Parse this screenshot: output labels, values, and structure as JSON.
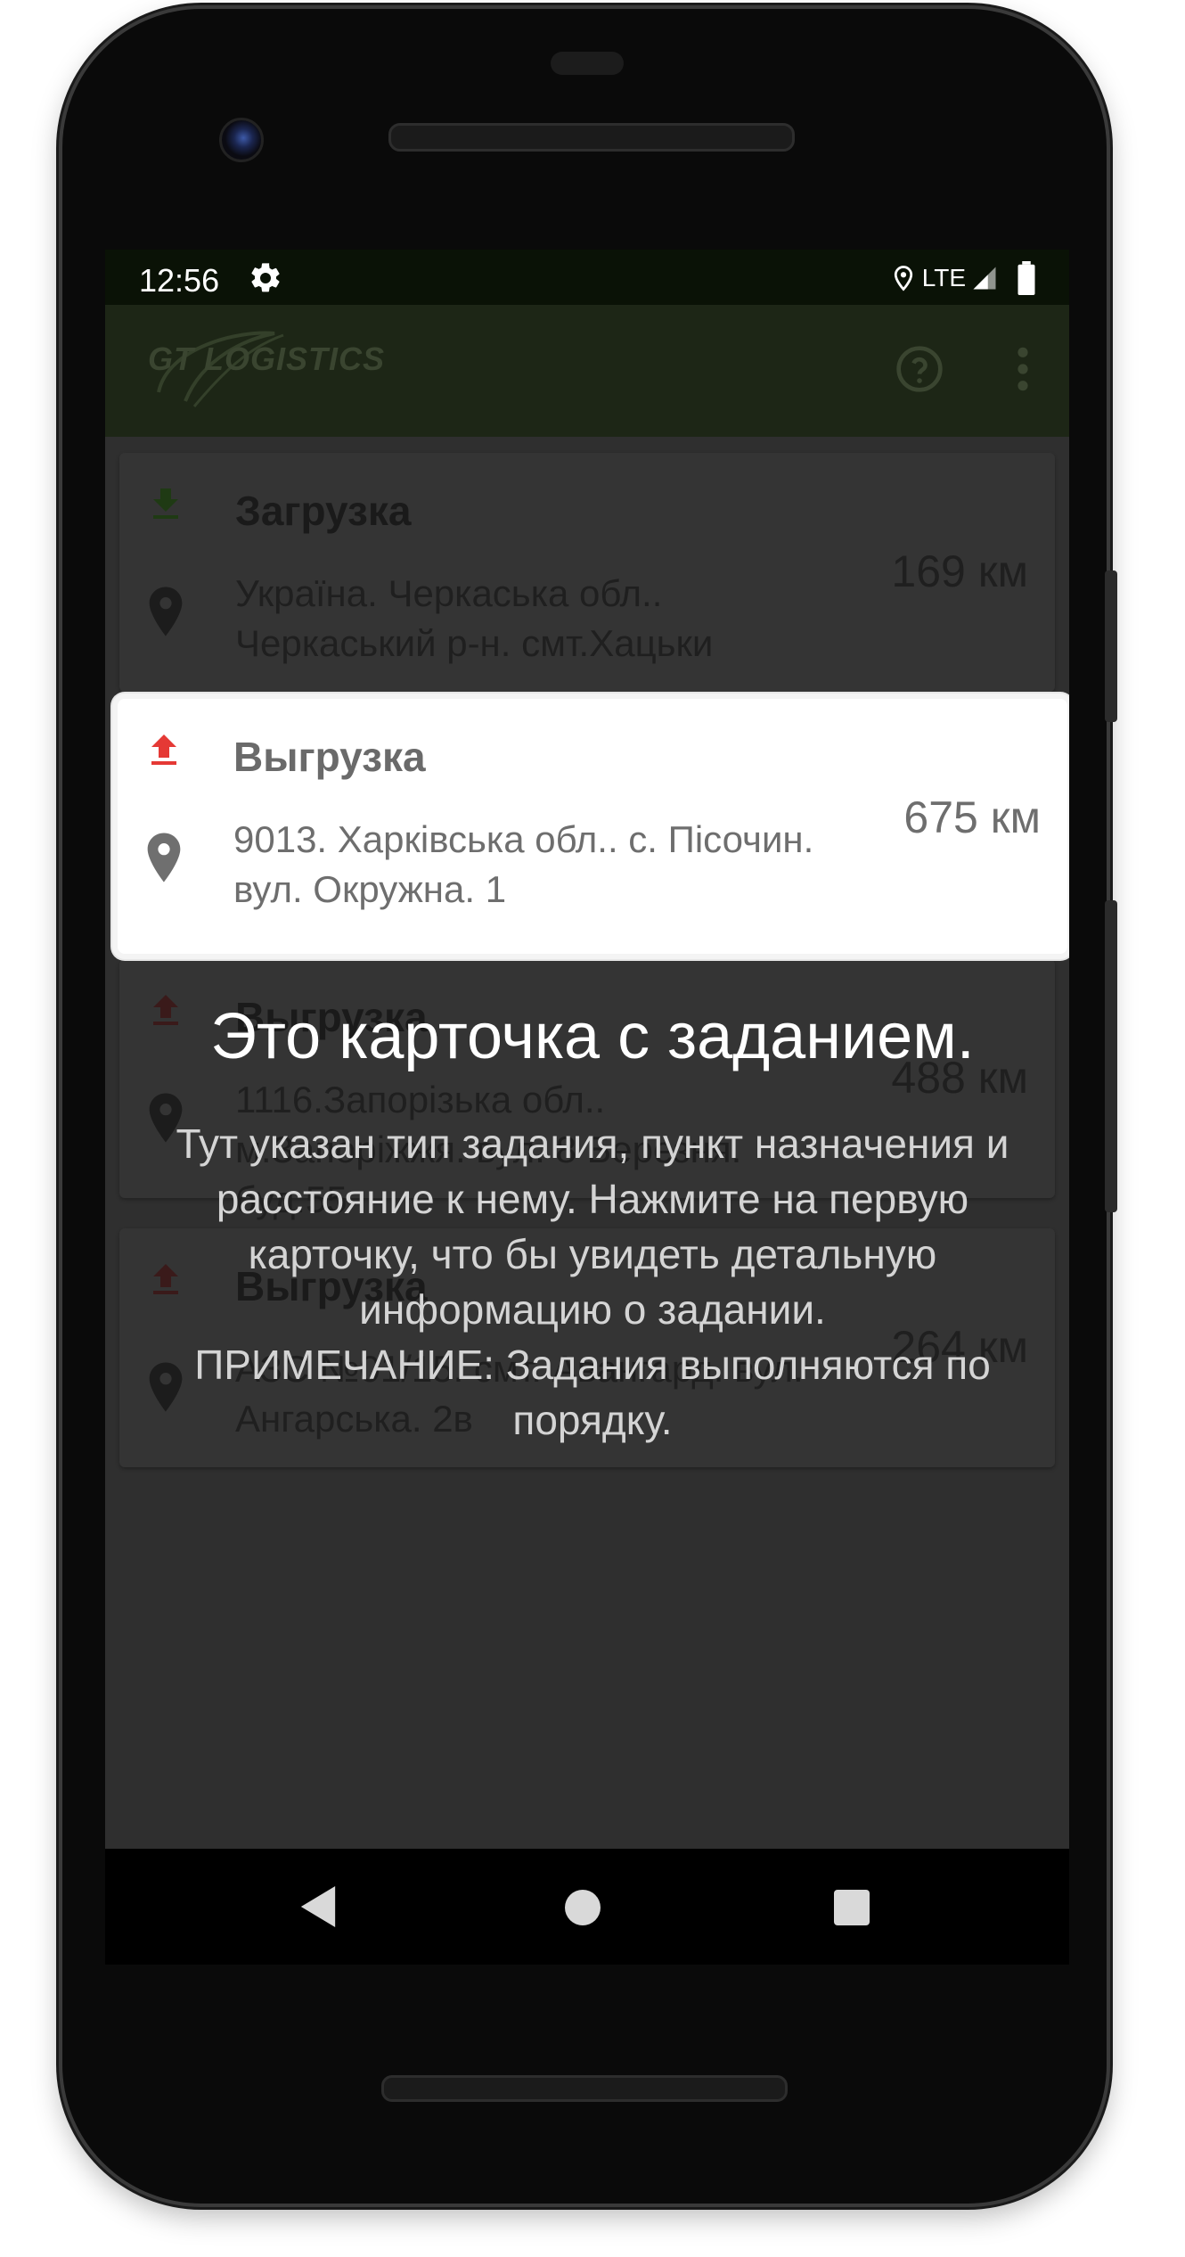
{
  "status_bar": {
    "time": "12:56",
    "network": "LTE",
    "icons": [
      "gear-icon",
      "location-icon",
      "signal-icon",
      "battery-icon"
    ]
  },
  "app_bar": {
    "logo_text": "GT LOGISTICS",
    "actions": [
      "help-icon",
      "more-vert-icon"
    ]
  },
  "tasks": [
    {
      "type": "Загрузка",
      "icon": "download-icon",
      "icon_color": "#2e7d32",
      "address": "Україна. Черкаська обл.. Черкаський р-н. смт.Хацьки",
      "distance": "169 км"
    },
    {
      "type": "Выгрузка",
      "icon": "upload-icon",
      "icon_color": "#e53935",
      "address": "9013. Харківська обл.. с. Пісочин. вул. Окружна. 1",
      "distance": "675 км"
    },
    {
      "type": "Выгрузка",
      "icon": "upload-icon",
      "icon_color": "#e53935",
      "address": "1116.Запорізька обл.. м.Запоріжжя. вул. 8 Березня. буд.55",
      "distance": "488 км"
    },
    {
      "type": "Выгрузка",
      "icon": "upload-icon",
      "icon_color": "#e53935",
      "address": "АЗС №01/15. смт. Авангард. вул. Ангарська. 2в",
      "distance": "264 км"
    }
  ],
  "tutorial": {
    "title": "Это карточка с заданием.",
    "body": "Тут указан тип задания, пункт назначения и расстояние к нему. Нажмите на первую карточку, что бы увидеть детальную информацию о задании.",
    "note": "ПРИМЕЧАНИЕ: Задания выполняются по порядку."
  },
  "nav_bar": {
    "buttons": [
      "back-icon",
      "home-icon",
      "recents-icon"
    ]
  }
}
